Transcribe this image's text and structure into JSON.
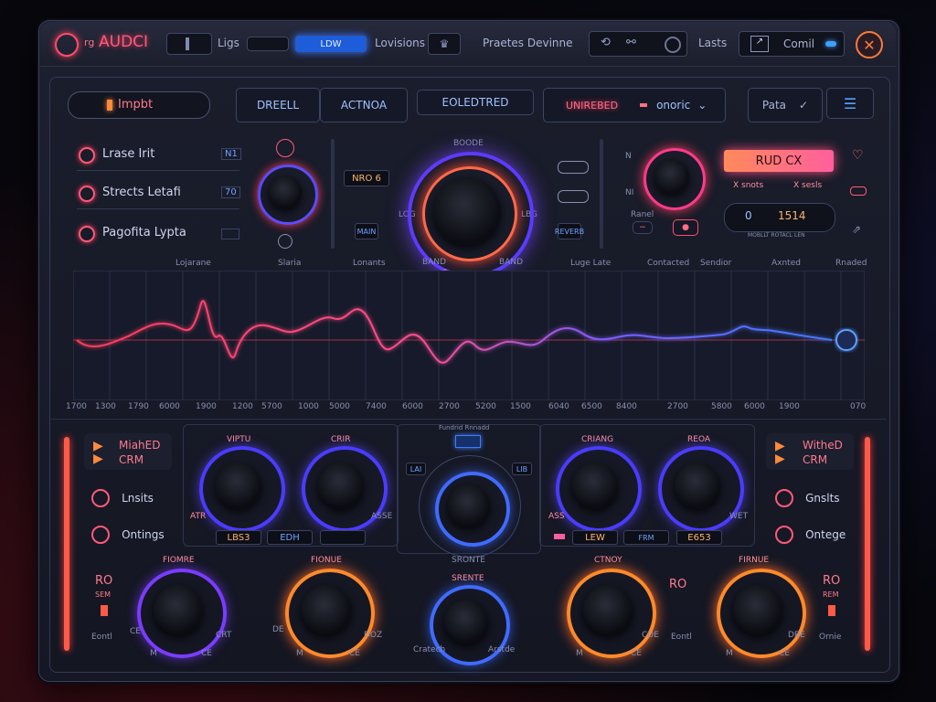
{
  "topbar": {
    "logo": "AUDCI",
    "logo_prefix": "rg",
    "label_ligs": "Ligs",
    "field_value": "LDW",
    "label_lovisions": "Lovisions",
    "presets_label": "Praetes Devinne",
    "label_lasts": "Lasts",
    "comp_label": "Comil"
  },
  "header": {
    "input_label": "Impbt",
    "tab_1": "DREELL",
    "tab_2": "ACTNOA",
    "dropdown_1": "EOLEDTRED",
    "dropdown_2_label": "UNIREBED",
    "dropdown_2_value": "onoric",
    "pata_label": "Pata"
  },
  "left_list": {
    "items": [
      {
        "label": "Lrase Irit",
        "value": "N1"
      },
      {
        "label": "Strects Letafi",
        "value": "70"
      },
      {
        "label": "Pagofita Lypta",
        "value": ""
      }
    ]
  },
  "center": {
    "top_label": "BOODE",
    "mini_display": "NRO 6",
    "left_box": "MAIN",
    "right_box": "REVERB",
    "left_tick": "LOG",
    "right_tick": "LBG",
    "bottom_left": "BAND",
    "bottom_right": "BAND",
    "bottom_mid": "6",
    "small_icon_right_1": "OO",
    "small_icon_right_2": "OO"
  },
  "right_header": {
    "mark_1": "N",
    "mark_2": "NI",
    "display": "RUD CX",
    "opt_1": "X snots",
    "opt_2": "X sesls",
    "value_left": "0",
    "value_right": "1514",
    "small_text": "MOBLLT ROTACL LEN",
    "ranel_label": "Ranel"
  },
  "graph": {
    "top_labels": [
      "Lojarane",
      "Slaria",
      "Lonants",
      "Luge Late",
      "Contacted",
      "Sendior",
      "Axnted",
      "Rnaded"
    ],
    "x_labels": [
      "1700",
      "1300",
      "1790",
      "6000",
      "1900",
      "1200",
      "5700",
      "1000",
      "5000",
      "7400",
      "6000",
      "2700",
      "5200",
      "1500",
      "6040",
      "6500",
      "8400",
      "2700",
      "5800",
      "6000",
      "1900",
      "070"
    ]
  },
  "lower_left": {
    "mode_title": "MiahED",
    "mode_sub": "CRM",
    "item_1": "Lnsits",
    "item_2": "Ontings",
    "ro_label": "RO",
    "ro_sub": "SEM",
    "ro_foot": "Eontl"
  },
  "lower_right": {
    "mode_title": "WitheD",
    "mode_sub": "CRM",
    "item_1": "Gnslts",
    "item_2": "Ontege",
    "ro_label": "RO",
    "ro_sub": "REM",
    "ro_foot": "Ornie"
  },
  "knobs_top": [
    {
      "label": "VIPTU",
      "value": "LBS3",
      "left_tag": "ATR",
      "right_tag": ""
    },
    {
      "label": "CRIR",
      "value": "EDH",
      "left_tag": "",
      "right_tag": "ASSE"
    },
    {
      "label": "CRIANG",
      "value": "LEW",
      "left_tag": "ASS",
      "right_tag": ""
    },
    {
      "label": "REOA",
      "value": "E653",
      "left_tag": "",
      "right_tag": "WET"
    }
  ],
  "center_knob": {
    "header": "Fundrid Rnnadd",
    "left_box": "LAI",
    "right_box": "LIB",
    "label": "SRONTE"
  },
  "knobs_bottom": [
    {
      "label": "FIOMRE",
      "min": "M",
      "max": "CE",
      "left": "CE",
      "right": "CRT"
    },
    {
      "label": "FIONUE",
      "min": "M",
      "max": "CE",
      "left": "DE",
      "right": "DOZ"
    },
    {
      "label": "SRENTE",
      "min": "Cratech",
      "max": "Arstde",
      "left": "",
      "right": ""
    },
    {
      "label": "CTNOY",
      "min": "M",
      "max": "CE",
      "left": "",
      "right": "CDE"
    },
    {
      "label": "FIRNUE",
      "min": "M",
      "max": "CE",
      "left": "",
      "right": "DBE"
    }
  ],
  "colors": {
    "accent_red": "#ff3b5c",
    "accent_blue": "#4c8cff",
    "accent_orange": "#ff8a3a"
  }
}
